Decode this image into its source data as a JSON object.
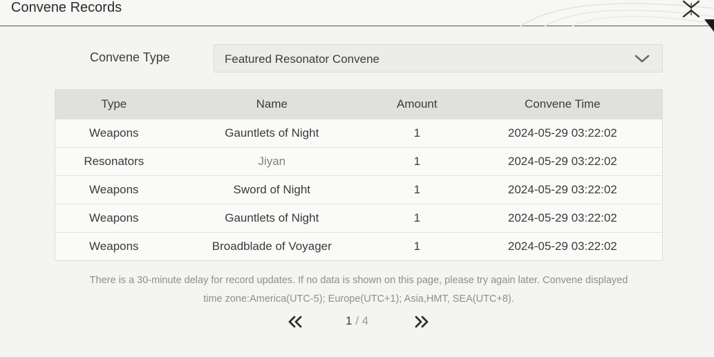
{
  "window": {
    "title": "Convene Records"
  },
  "filter": {
    "label": "Convene Type",
    "selected": "Featured Resonator Convene"
  },
  "table": {
    "headers": [
      "Type",
      "Name",
      "Amount",
      "Convene Time"
    ],
    "rows": [
      {
        "type": "Weapons",
        "name": "Gauntlets of Night",
        "amount": "1",
        "time": "2024-05-29 03:22:02"
      },
      {
        "type": "Resonators",
        "name": "Jiyan",
        "amount": "1",
        "time": "2024-05-29 03:22:02"
      },
      {
        "type": "Weapons",
        "name": "Sword of Night",
        "amount": "1",
        "time": "2024-05-29 03:22:02"
      },
      {
        "type": "Weapons",
        "name": "Gauntlets of Night",
        "amount": "1",
        "time": "2024-05-29 03:22:02"
      },
      {
        "type": "Weapons",
        "name": "Broadblade of Voyager",
        "amount": "1",
        "time": "2024-05-29 03:22:02"
      }
    ]
  },
  "notice": {
    "line1": "There is a 30-minute delay for record updates. If no data is shown on this page, please try again later. Convene displayed",
    "line2": "time zone:America(UTC-5); Europe(UTC+1); Asia,HMT, SEA(UTC+8)."
  },
  "pagination": {
    "current": "1",
    "separator": "/",
    "total": "4"
  },
  "icons": {
    "close": "close-x-icon",
    "dropdown": "chevron-down-icon",
    "prev": "double-chevron-left-icon",
    "next": "double-chevron-right-icon"
  },
  "colors": {
    "highlight_name": "#8a7f77",
    "header_bg": "#e0e0dd"
  }
}
